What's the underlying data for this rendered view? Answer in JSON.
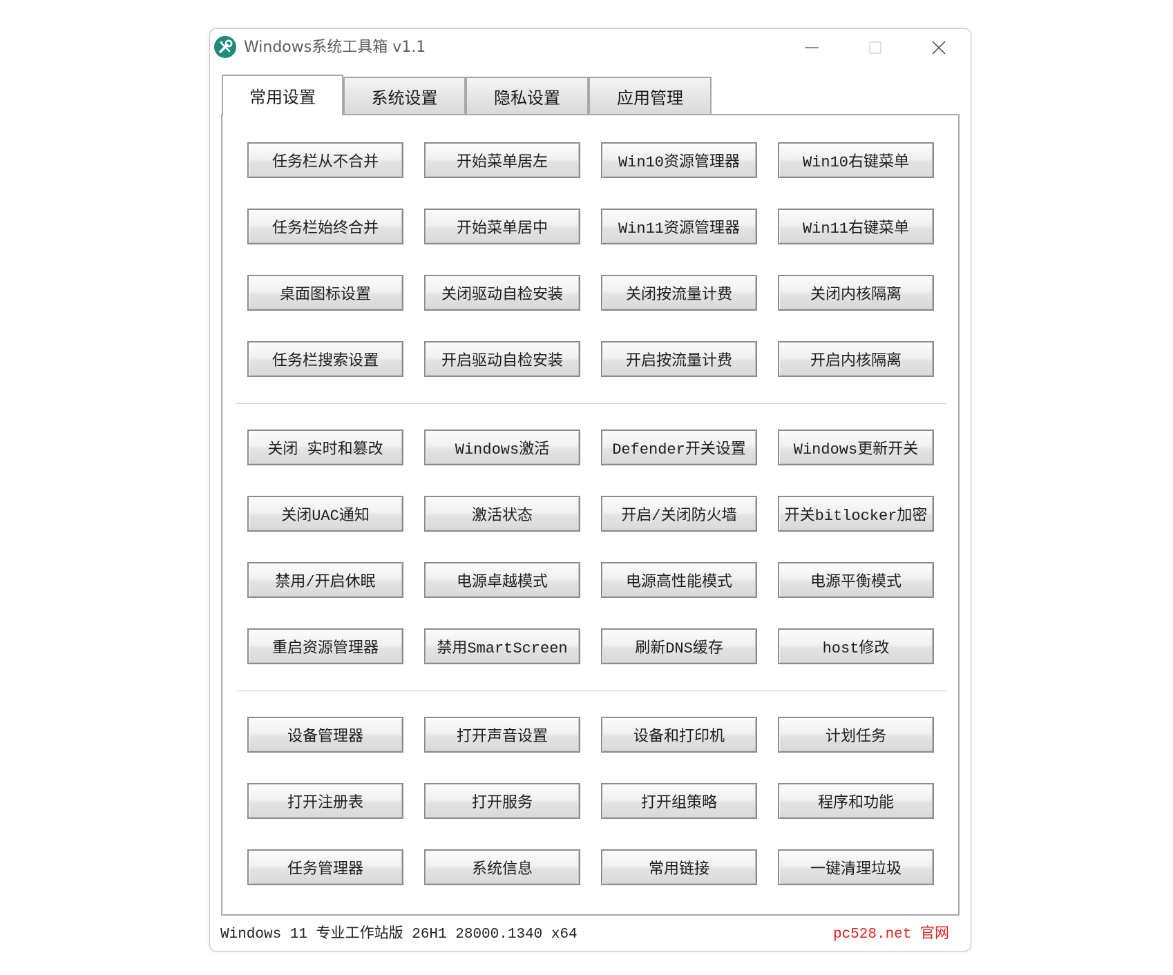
{
  "window": {
    "title": "Windows系统工具箱 v1.1"
  },
  "tabs": [
    {
      "label": "常用设置",
      "selected": true
    },
    {
      "label": "系统设置",
      "selected": false
    },
    {
      "label": "隐私设置",
      "selected": false
    },
    {
      "label": "应用管理",
      "selected": false
    }
  ],
  "groups": [
    {
      "rows": [
        [
          "任务栏从不合并",
          "开始菜单居左",
          "Win10资源管理器",
          "Win10右键菜单"
        ],
        [
          "任务栏始终合并",
          "开始菜单居中",
          "Win11资源管理器",
          "Win11右键菜单"
        ],
        [
          "桌面图标设置",
          "关闭驱动自检安装",
          "关闭按流量计费",
          "关闭内核隔离"
        ],
        [
          "任务栏搜索设置",
          "开启驱动自检安装",
          "开启按流量计费",
          "开启内核隔离"
        ]
      ]
    },
    {
      "rows": [
        [
          "关闭 实时和篡改",
          "Windows激活",
          "Defender开关设置",
          "Windows更新开关"
        ],
        [
          "关闭UAC通知",
          "激活状态",
          "开启/关闭防火墙",
          "开关bitlocker加密"
        ],
        [
          "禁用/开启休眠",
          "电源卓越模式",
          "电源高性能模式",
          "电源平衡模式"
        ],
        [
          "重启资源管理器",
          "禁用SmartScreen",
          "刷新DNS缓存",
          "host修改"
        ]
      ]
    },
    {
      "rows": [
        [
          "设备管理器",
          "打开声音设置",
          "设备和打印机",
          "计划任务"
        ],
        [
          "打开注册表",
          "打开服务",
          "打开组策略",
          "程序和功能"
        ],
        [
          "任务管理器",
          "系统信息",
          "常用链接",
          "一键清理垃圾"
        ]
      ]
    }
  ],
  "status": {
    "system_info": "Windows 11 专业工作站版 26H1 28000.1340 x64",
    "website": "pc528.net 官网"
  },
  "colors": {
    "accent": "#1f8b7c",
    "website": "#e0211d",
    "button_border": "#8c8c8c"
  },
  "icons": {
    "app": "toolbox-icon",
    "minimize": "minimize-icon",
    "maximize": "maximize-icon",
    "close": "close-icon"
  }
}
